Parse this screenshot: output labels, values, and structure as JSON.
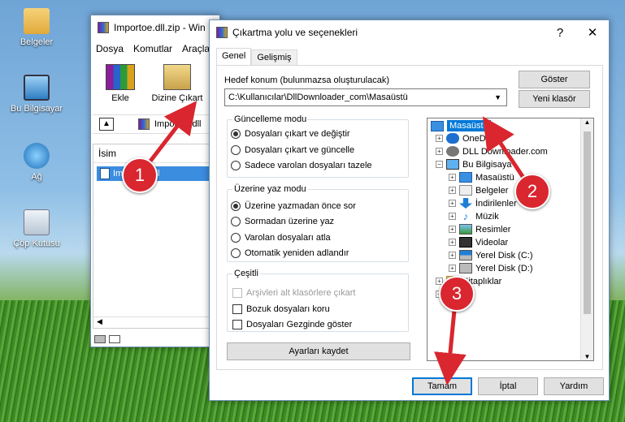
{
  "desktop": {
    "icons": [
      {
        "label": "Belgeler",
        "icon": "folder-icon"
      },
      {
        "label": "Bu Bilgisayar",
        "icon": "computer-icon"
      },
      {
        "label": "Ağ",
        "icon": "network-icon"
      },
      {
        "label": "Çöp Kutusu",
        "icon": "recycle-bin-icon"
      }
    ]
  },
  "winrar": {
    "title": "Importoe.dll.zip - Win",
    "menu": [
      "Dosya",
      "Komutlar",
      "Araçla"
    ],
    "toolbar": {
      "add": "Ekle",
      "extract": "Dizine Çıkart"
    },
    "path": "Importoe.dll",
    "column_name": "İsim",
    "file": "Importoe.dll"
  },
  "dialog": {
    "title": "Çıkartma yolu ve seçenekleri",
    "help": "?",
    "close": "✕",
    "tabs": [
      "Genel",
      "Gelişmiş"
    ],
    "dest_label": "Hedef konum (bulunmazsa oluşturulacak)",
    "dest_value": "C:\\Kullanıcılar\\DllDownloader_com\\Masaüstü",
    "show_button": "Göster",
    "new_folder_button": "Yeni klasör",
    "update_mode": {
      "title": "Güncelleme modu",
      "options": [
        "Dosyaları çıkart ve değiştir",
        "Dosyaları çıkart ve güncelle",
        "Sadece varolan dosyaları tazele"
      ],
      "selected": 0
    },
    "overwrite_mode": {
      "title": "Üzerine yaz modu",
      "options": [
        "Üzerine yazmadan önce sor",
        "Sormadan üzerine yaz",
        "Varolan dosyaları atla",
        "Otomatik yeniden adlandır"
      ],
      "selected": 0
    },
    "misc": {
      "title": "Çeşitli",
      "options": [
        "Arşivleri alt klasörlere çıkart",
        "Bozuk dosyaları koru",
        "Dosyaları Gezginde göster"
      ]
    },
    "save_settings": "Ayarları kaydet",
    "tree": [
      {
        "label": "Masaüstü",
        "level": 0,
        "selected": true
      },
      {
        "label": "OneD",
        "level": 1
      },
      {
        "label": "DLL Downloader.com",
        "level": 1
      },
      {
        "label": "Bu Bilgisaya",
        "level": 1
      },
      {
        "label": "Masaüstü",
        "level": 2
      },
      {
        "label": "Belgeler",
        "level": 2
      },
      {
        "label": "İndirilenler",
        "level": 2
      },
      {
        "label": "Müzik",
        "level": 2
      },
      {
        "label": "Resimler",
        "level": 2
      },
      {
        "label": "Videolar",
        "level": 2
      },
      {
        "label": "Yerel Disk (C:)",
        "level": 2
      },
      {
        "label": "Yerel Disk (D:)",
        "level": 2
      },
      {
        "label": "Kitaplıklar",
        "level": 1
      },
      {
        "label": "A",
        "level": 1
      }
    ],
    "ok": "Tamam",
    "cancel": "İptal",
    "help_button": "Yardım"
  },
  "badges": [
    "1",
    "2",
    "3"
  ]
}
